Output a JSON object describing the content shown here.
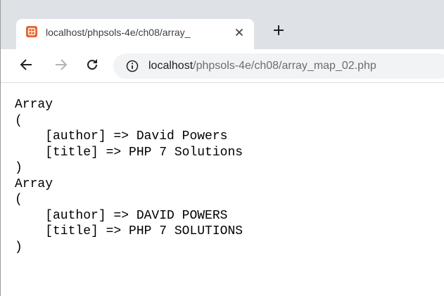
{
  "tab": {
    "title": "localhost/phpsols-4e/ch08/array_",
    "favicon": "server-favicon-icon",
    "close_icon": "close-icon"
  },
  "toolbar": {
    "back_icon": "back-arrow-icon",
    "forward_icon": "forward-arrow-icon",
    "reload_icon": "reload-icon",
    "info_icon": "info-icon",
    "url_host": "localhost",
    "url_path": "/phpsols-4e/ch08/array_map_02.php"
  },
  "output_lines": [
    "Array",
    "(",
    "    [author] => David Powers",
    "    [title] => PHP 7 Solutions",
    ")",
    "Array",
    "(",
    "    [author] => DAVID POWERS",
    "    [title] => PHP 7 SOLUTIONS",
    ")"
  ],
  "colors": {
    "tabstrip_bg": "#dee1e6",
    "omnibox_bg": "#f1f3f4",
    "favicon": "#e8622a",
    "url_path": "#6b6e72"
  }
}
